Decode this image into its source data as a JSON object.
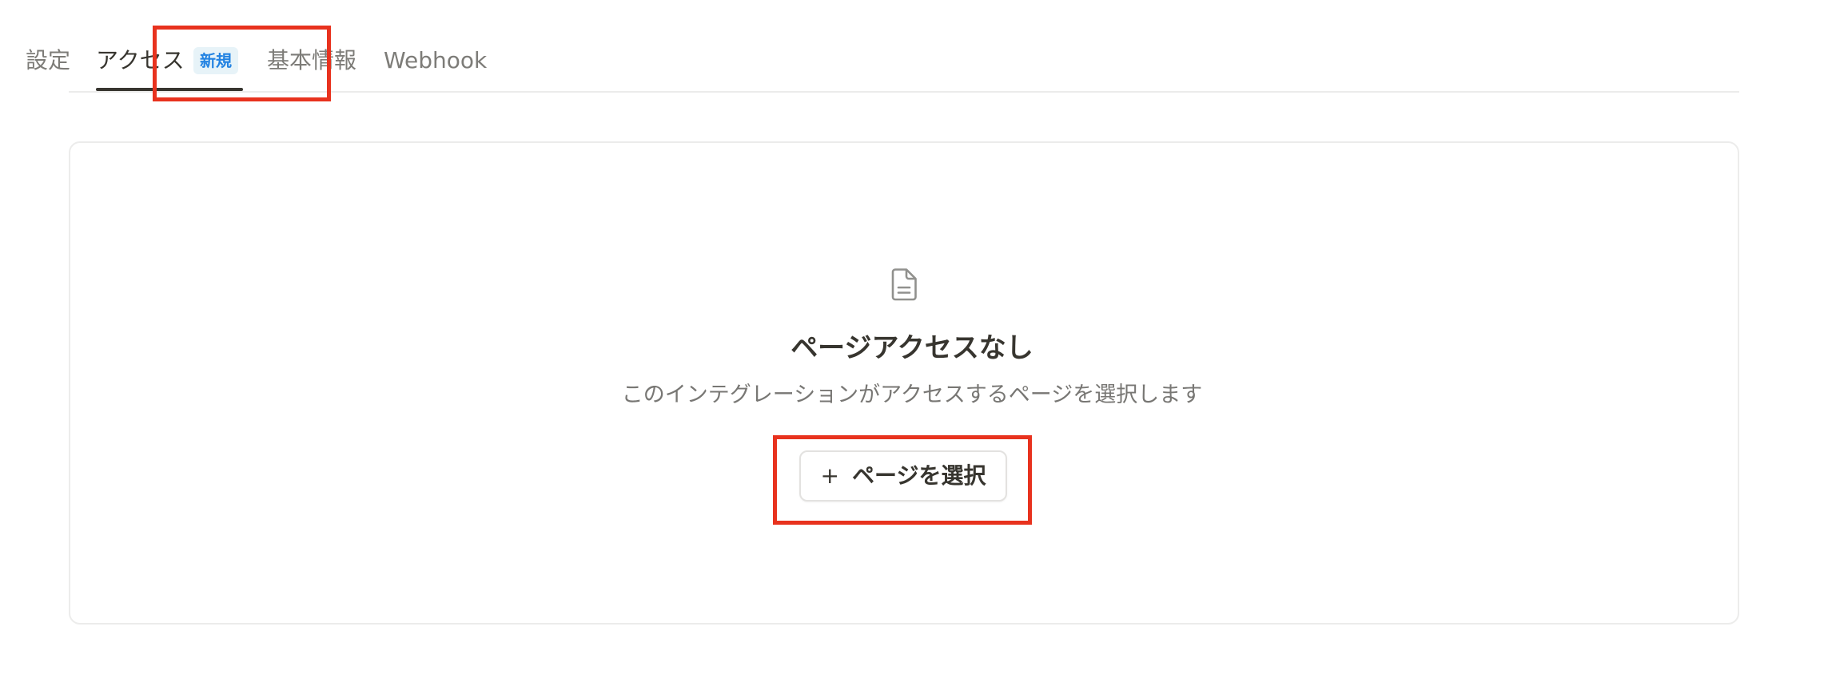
{
  "tabs": {
    "items": [
      {
        "label": "設定"
      },
      {
        "label": "アクセス",
        "badge": "新規"
      },
      {
        "label": "基本情報"
      },
      {
        "label": "Webhook"
      }
    ],
    "active": "アクセス"
  },
  "empty_state": {
    "icon": "document-icon",
    "title": "ページアクセスなし",
    "description": "このインテグレーションがアクセスするページを選択します",
    "button": {
      "icon": "plus-icon",
      "icon_glyph": "+",
      "label": "ページを選択"
    }
  },
  "colors": {
    "accent": "#2383e2",
    "badge_bg": "#e7f3f8",
    "annotation": "#e8321e",
    "text": "#37352f",
    "muted": "#787774"
  }
}
